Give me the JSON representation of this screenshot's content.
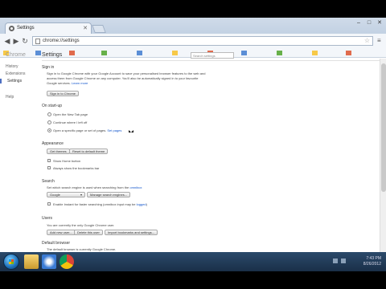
{
  "browser": {
    "tab_title": "Settings",
    "url": "chrome://settings",
    "window_controls": [
      "–",
      "□",
      "✕"
    ],
    "nav": {
      "back": "◀",
      "forward": "▶",
      "reload": "↻"
    }
  },
  "sidebar": {
    "title": "Chrome",
    "items": [
      {
        "label": "History"
      },
      {
        "label": "Extensions"
      },
      {
        "label": "Settings"
      },
      {
        "label": "Help"
      }
    ]
  },
  "header": {
    "title": "Settings",
    "search_placeholder": "Search settings"
  },
  "signin": {
    "heading": "Sign in",
    "line1": "Sign in to Google Chrome with your Google Account to save your personalised browser features to the web and",
    "line2": "access them from Google Chrome on any computer. You'll also be automatically signed in to your favourite",
    "line3_prefix": "Google services.",
    "line3_link": "Learn more",
    "button": "Sign in to Chrome"
  },
  "startup": {
    "heading": "On start-up",
    "options": [
      {
        "label": "Open the New Tab page",
        "selected": false
      },
      {
        "label": "Continue where I left off",
        "selected": false
      },
      {
        "label": "Open a specific page or set of pages.",
        "selected": true
      }
    ],
    "set_pages_link": "Set pages"
  },
  "appearance": {
    "heading": "Appearance",
    "get_themes": "Get themes",
    "reset_theme": "Reset to default theme",
    "checks": [
      {
        "label": "Show Home button",
        "checked": false
      },
      {
        "label": "Always show the bookmarks bar",
        "checked": false
      }
    ]
  },
  "search": {
    "heading": "Search",
    "desc_prefix": "Set which search engine is used when searching from the",
    "desc_link": "omnibox",
    "engine_select": "Google",
    "manage_button": "Manage search engines...",
    "instant_label": "Enable Instant for faster searching (omnibox input may be",
    "instant_link": "logged",
    "instant_suffix": ")"
  },
  "users": {
    "heading": "Users",
    "desc": "You are currently the only Google Chrome user.",
    "buttons": [
      "Add new user...",
      "Delete this user",
      "Import bookmarks and settings..."
    ]
  },
  "default_browser": {
    "heading": "Default browser",
    "desc": "The default browser is currently Google Chrome."
  },
  "tray": {
    "time": "7:43 PM",
    "date": "8/26/2012"
  }
}
